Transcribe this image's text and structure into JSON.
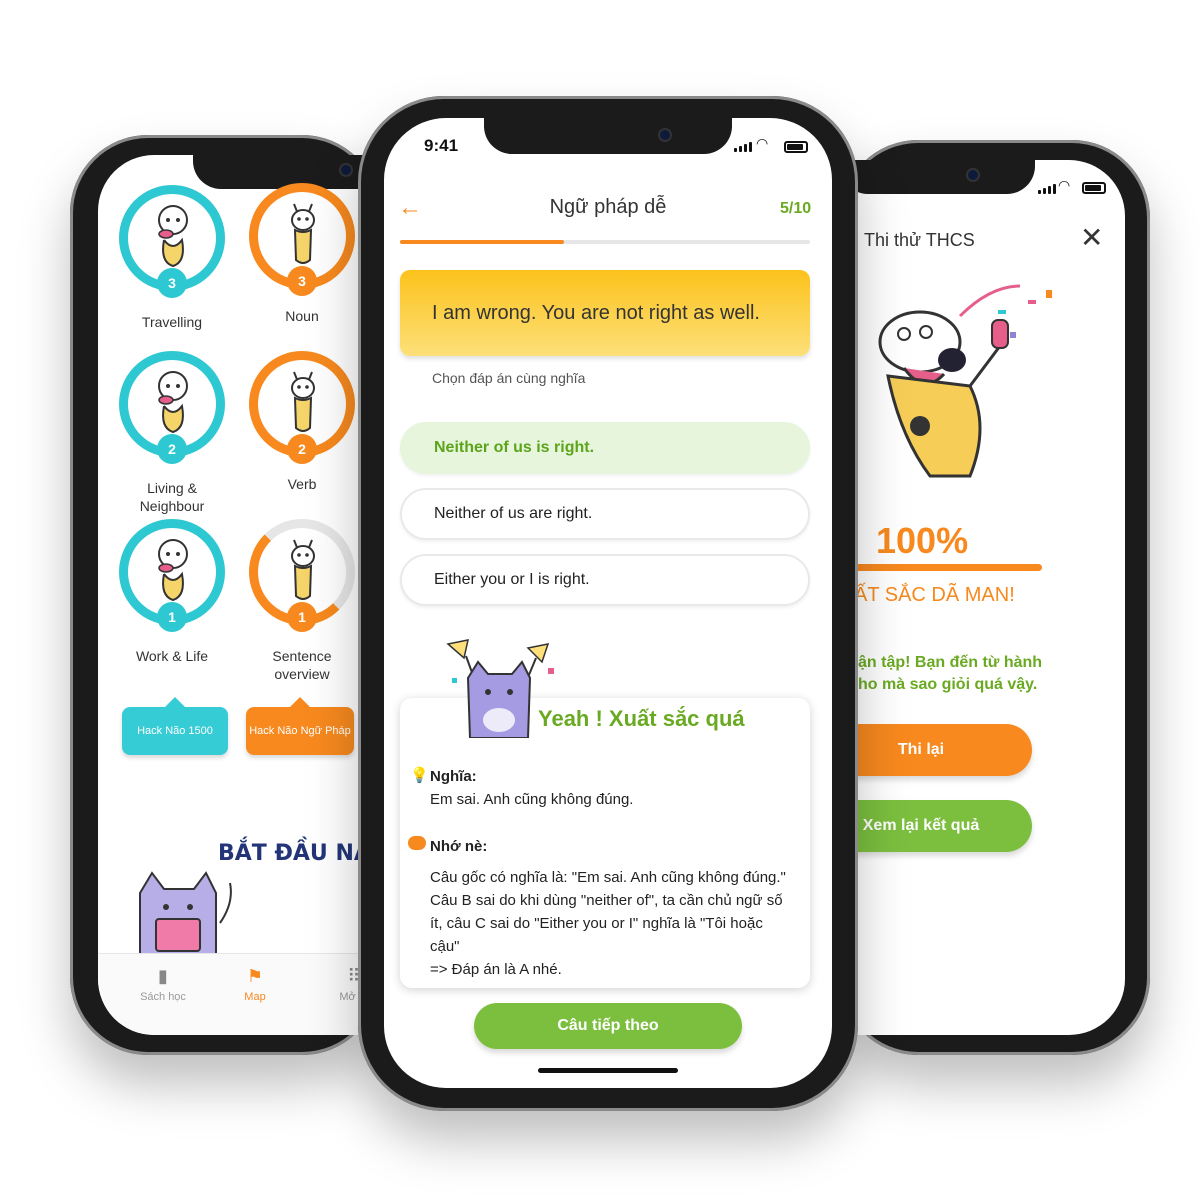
{
  "left_screen": {
    "lessons": [
      {
        "label": "Travelling",
        "level": "3",
        "color": "teal"
      },
      {
        "label": "Noun",
        "level": "3",
        "color": "orange"
      },
      {
        "label": "Living &\nNeighbour",
        "level": "2",
        "color": "teal"
      },
      {
        "label": "Verb",
        "level": "2",
        "color": "orange"
      },
      {
        "label": "Work & Life",
        "level": "1",
        "color": "teal"
      },
      {
        "label": "Sentence\noverview",
        "level": "1",
        "color": "orange-partial"
      }
    ],
    "hack_buttons": [
      {
        "label": "Hack Não 1500",
        "color": "#36ccd6"
      },
      {
        "label": "Hack Não Ngữ Pháp",
        "color": "#f7891e"
      }
    ],
    "start_banner": "BẮT ĐẦU NÀO",
    "nav": [
      {
        "label": "Sách học",
        "icon": "book-icon"
      },
      {
        "label": "Map",
        "icon": "map-flag-icon",
        "active": true
      },
      {
        "label": "Mở rộ",
        "icon": "grid-icon"
      }
    ]
  },
  "center_screen": {
    "status": {
      "time": "9:41"
    },
    "header": {
      "title": "Ngữ pháp dễ",
      "progress_text": "5/10",
      "progress": 0.4
    },
    "question": "I am wrong. You are not right as well.",
    "instruction": "Chọn đáp án cùng nghĩa",
    "answers": [
      {
        "text": "Neither of us is right.",
        "state": "correct"
      },
      {
        "text": "Neither of us are right.",
        "state": "normal"
      },
      {
        "text": "Either you or I is right.",
        "state": "normal"
      }
    ],
    "feedback": {
      "title": "Yeah ! Xuất sắc quá",
      "meaning_label": "Nghĩa:",
      "meaning_text": "Em sai. Anh cũng không đúng.",
      "note_label": "Nhớ nè:",
      "note_lines": [
        "Câu gốc có nghĩa là: \"Em sai. Anh cũng không đúng.\"",
        "Câu B sai do khi dùng \"neither of\", ta cần chủ ngữ số",
        "ít, câu C sai do \"Either you or I\" nghĩa là \"Tôi hoặc",
        "cậu\"",
        "=> Đáp án là A nhé."
      ]
    },
    "next_button": "Câu tiếp theo"
  },
  "right_screen": {
    "title": "Thi thử THCS",
    "score": "100%",
    "score_progress": 1.0,
    "headline": "ẤT SẮC DÃ MAN!",
    "message_lines": [
      "ận tập! Bạn đến từ hành",
      "ho mà sao giỏi quá vậy."
    ],
    "retry_button": "Thi lại",
    "review_button": "Xem lại kết quả"
  },
  "colors": {
    "teal": "#2ec8d2",
    "orange": "#f7891e",
    "green": "#7cbf3f",
    "yellow": "#fcc21b",
    "purple": "#8e84d6"
  }
}
